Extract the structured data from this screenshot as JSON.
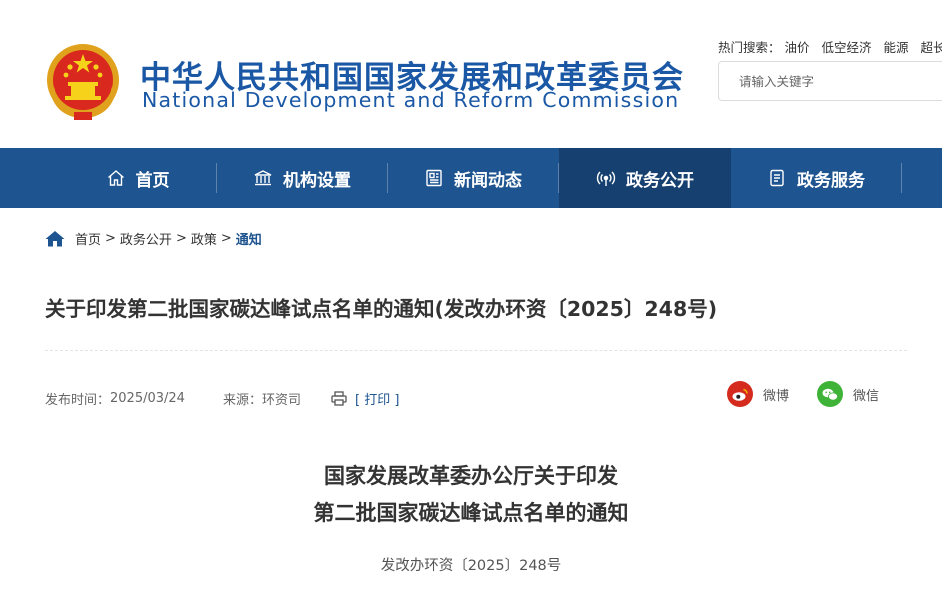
{
  "header": {
    "site_title_cn": "中华人民共和国国家发展和改革委员会",
    "site_title_en": "National Development and Reform Commission",
    "hot_search_label": "热门搜索：",
    "hot_links": [
      "油价",
      "低空经济",
      "能源",
      "超长"
    ],
    "search_placeholder": "请输入关键字"
  },
  "nav": {
    "items": [
      {
        "label": "首页",
        "icon": "home-icon"
      },
      {
        "label": "机构设置",
        "icon": "institution-icon"
      },
      {
        "label": "新闻动态",
        "icon": "newspaper-icon"
      },
      {
        "label": "政务公开",
        "icon": "broadcast-icon",
        "active": true
      },
      {
        "label": "政务服务",
        "icon": "document-icon"
      }
    ]
  },
  "breadcrumb": {
    "items": [
      "首页",
      "政务公开",
      "政策",
      "通知"
    ],
    "separator": ">"
  },
  "article": {
    "title": "关于印发第二批国家碳达峰试点名单的通知(发改办环资〔2025〕248号)",
    "publish_label": "发布时间：",
    "publish_date": "2025/03/24",
    "source_label": "来源：",
    "source": "环资司",
    "print_label": "[ 打印 ]",
    "share": {
      "weibo": "微博",
      "wechat": "微信"
    },
    "doc_heading_line1": "国家发展改革委办公厅关于印发",
    "doc_heading_line2": "第二批国家碳达峰试点名单的通知",
    "doc_number": "发改办环资〔2025〕248号"
  },
  "colors": {
    "brand_blue": "#1a58a6",
    "nav_bg": "#1e548f",
    "nav_active_bg": "#16406f",
    "weibo_red": "#d52b1e",
    "wechat_green": "#3fb338"
  }
}
